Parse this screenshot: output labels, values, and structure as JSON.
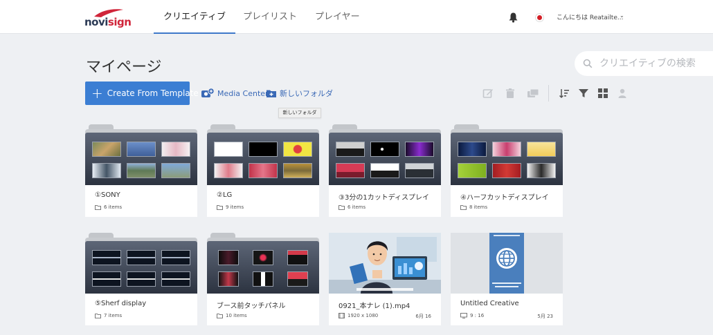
{
  "header": {
    "logo_a": "novi",
    "logo_b": "sign",
    "tabs": [
      {
        "label": "クリエイティブ",
        "active": true
      },
      {
        "label": "プレイリスト",
        "active": false
      },
      {
        "label": "プレイヤー",
        "active": false
      }
    ],
    "greeting": "こんにちは Reatailte...",
    "caret": "⌄"
  },
  "page_title": "マイページ",
  "search": {
    "placeholder": "クリエイティブの検索"
  },
  "toolbar": {
    "create_label": "Create From Template",
    "media_center_label": "Media Center",
    "new_folder_label": "新しいフォルダ",
    "tooltip": "新しいフォルダ"
  },
  "folders": [
    {
      "name": "①SONY",
      "items": "6 items"
    },
    {
      "name": "②LG",
      "items": "9 items"
    },
    {
      "name": "③3分の1カットディスプレイ",
      "items": "6 items"
    },
    {
      "name": "④ハーフカットディスプレイ",
      "items": "8 items"
    },
    {
      "name": "⑤Sherf display",
      "items": "7 items"
    },
    {
      "name": "ブース前タッチパネル",
      "items": "10 items"
    }
  ],
  "creatives": [
    {
      "name": "0921_本ナレ (1).mp4",
      "meta": "1920 x 1080",
      "date": "6月 16"
    },
    {
      "name": "Untitled Creative",
      "meta": "9 : 16",
      "date": "5月 23"
    }
  ],
  "colors": {
    "accent": "#3b7ed3",
    "brand_red": "#d0253a",
    "brand_navy": "#2b3a55"
  }
}
